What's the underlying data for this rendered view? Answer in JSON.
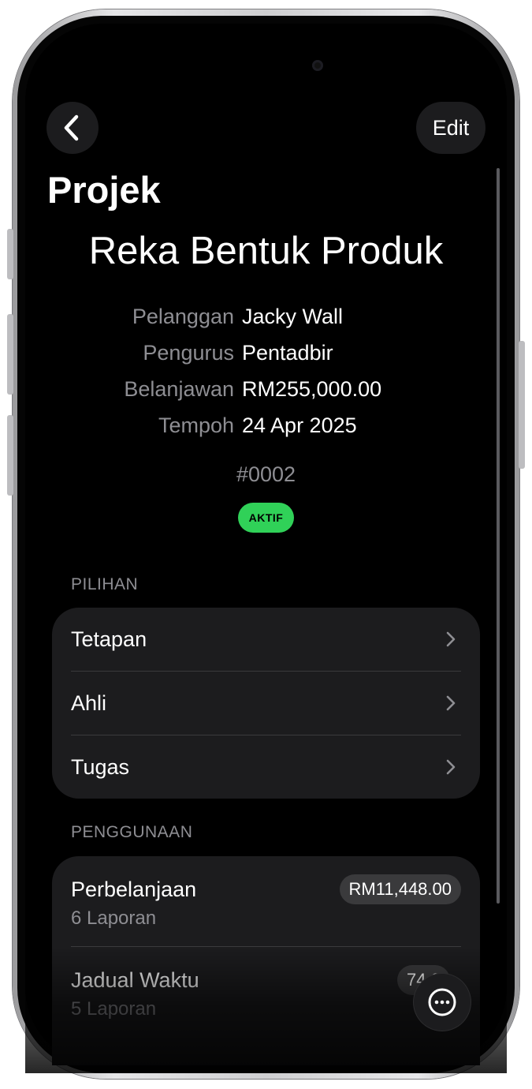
{
  "nav": {
    "back_icon": "chevron-left-icon",
    "edit_label": "Edit"
  },
  "page": {
    "large_title": "Projek",
    "project_name": "Reka Bentuk Produk"
  },
  "details": [
    {
      "label": "Pelanggan",
      "value": "Jacky Wall"
    },
    {
      "label": "Pengurus",
      "value": "Pentadbir"
    },
    {
      "label": "Belanjawan",
      "value": "RM255,000.00"
    },
    {
      "label": "Tempoh",
      "value": "24 Apr 2025"
    }
  ],
  "project_id": "#0002",
  "status": {
    "label": "AKTIF",
    "color": "#30d158"
  },
  "options": {
    "header": "PILIHAN",
    "items": [
      {
        "label": "Tetapan"
      },
      {
        "label": "Ahli"
      },
      {
        "label": "Tugas"
      }
    ]
  },
  "usage": {
    "header": "PENGGUNAAN",
    "items": [
      {
        "title": "Perbelanjaan",
        "subtitle": "6 Laporan",
        "amount": "RM11,448.00"
      },
      {
        "title": "Jadual Waktu",
        "subtitle": "5 Laporan",
        "amount": "74.0"
      }
    ]
  },
  "more_icon": "ellipsis-circle-icon"
}
